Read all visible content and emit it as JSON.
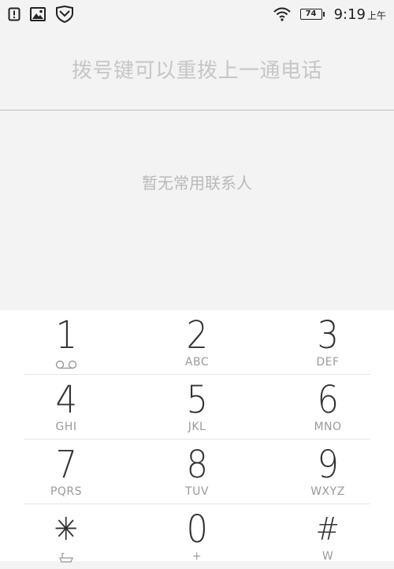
{
  "status_bar": {
    "time": "9:19",
    "ampm": "上午",
    "battery": "74",
    "icons": [
      "alert-icon",
      "image-icon",
      "shield-icon",
      "wifi-icon",
      "battery-icon"
    ]
  },
  "dialer": {
    "hint": "拨号键可以重拨上一通电话"
  },
  "favorites": {
    "empty_text": "暂无常用联系人"
  },
  "keypad": {
    "rows": [
      [
        {
          "digit": "1",
          "letters": "",
          "icon": "voicemail-icon"
        },
        {
          "digit": "2",
          "letters": "ABC"
        },
        {
          "digit": "3",
          "letters": "DEF"
        }
      ],
      [
        {
          "digit": "4",
          "letters": "GHI"
        },
        {
          "digit": "5",
          "letters": "JKL"
        },
        {
          "digit": "6",
          "letters": "MNO"
        }
      ],
      [
        {
          "digit": "7",
          "letters": "PQRS"
        },
        {
          "digit": "8",
          "letters": "TUV"
        },
        {
          "digit": "9",
          "letters": "WXYZ"
        }
      ],
      [
        {
          "digit": "✳",
          "letters": "",
          "icon": "bathtub-icon"
        },
        {
          "digit": "0",
          "letters": "+"
        },
        {
          "digit": "#",
          "letters": "W"
        }
      ]
    ]
  }
}
